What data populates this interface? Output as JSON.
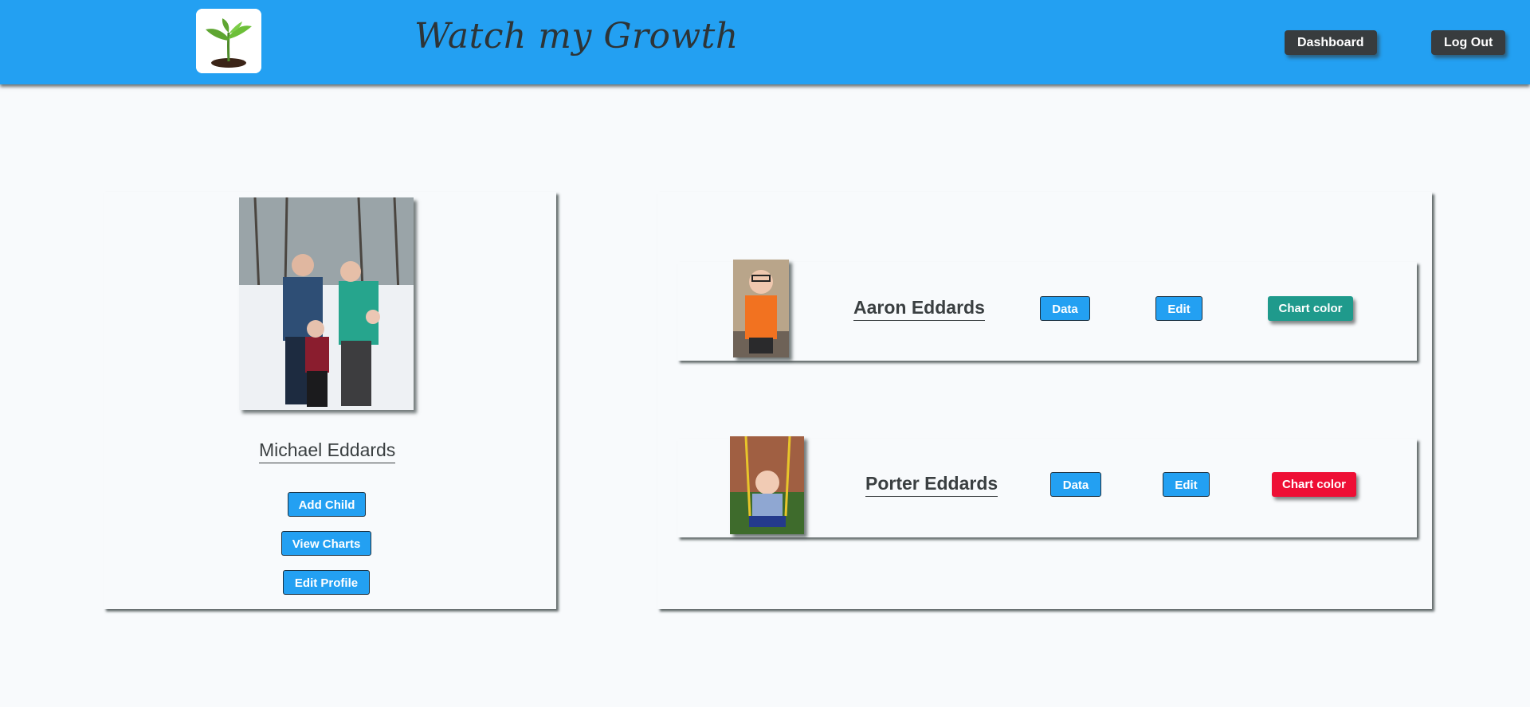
{
  "header": {
    "title": "Watch my Growth",
    "dashboard_label": "Dashboard",
    "logout_label": "Log Out"
  },
  "profile": {
    "name": "Michael Eddards",
    "add_child_label": "Add Child",
    "view_charts_label": "View Charts",
    "edit_profile_label": "Edit Profile"
  },
  "children": [
    {
      "name": "Aaron Eddards",
      "data_label": "Data",
      "edit_label": "Edit",
      "chart_color_label": "Chart color",
      "chart_color": "#1f9a8c"
    },
    {
      "name": "Porter Eddards",
      "data_label": "Data",
      "edit_label": "Edit",
      "chart_color_label": "Chart color",
      "chart_color": "#ee0f35"
    }
  ],
  "colors": {
    "header_bg": "#23a0f2",
    "button_bg": "#23a0f2",
    "nav_button_bg": "#383c3e",
    "page_bg": "#f8fafc"
  },
  "icons": {
    "logo": "sprout-logo-icon"
  }
}
